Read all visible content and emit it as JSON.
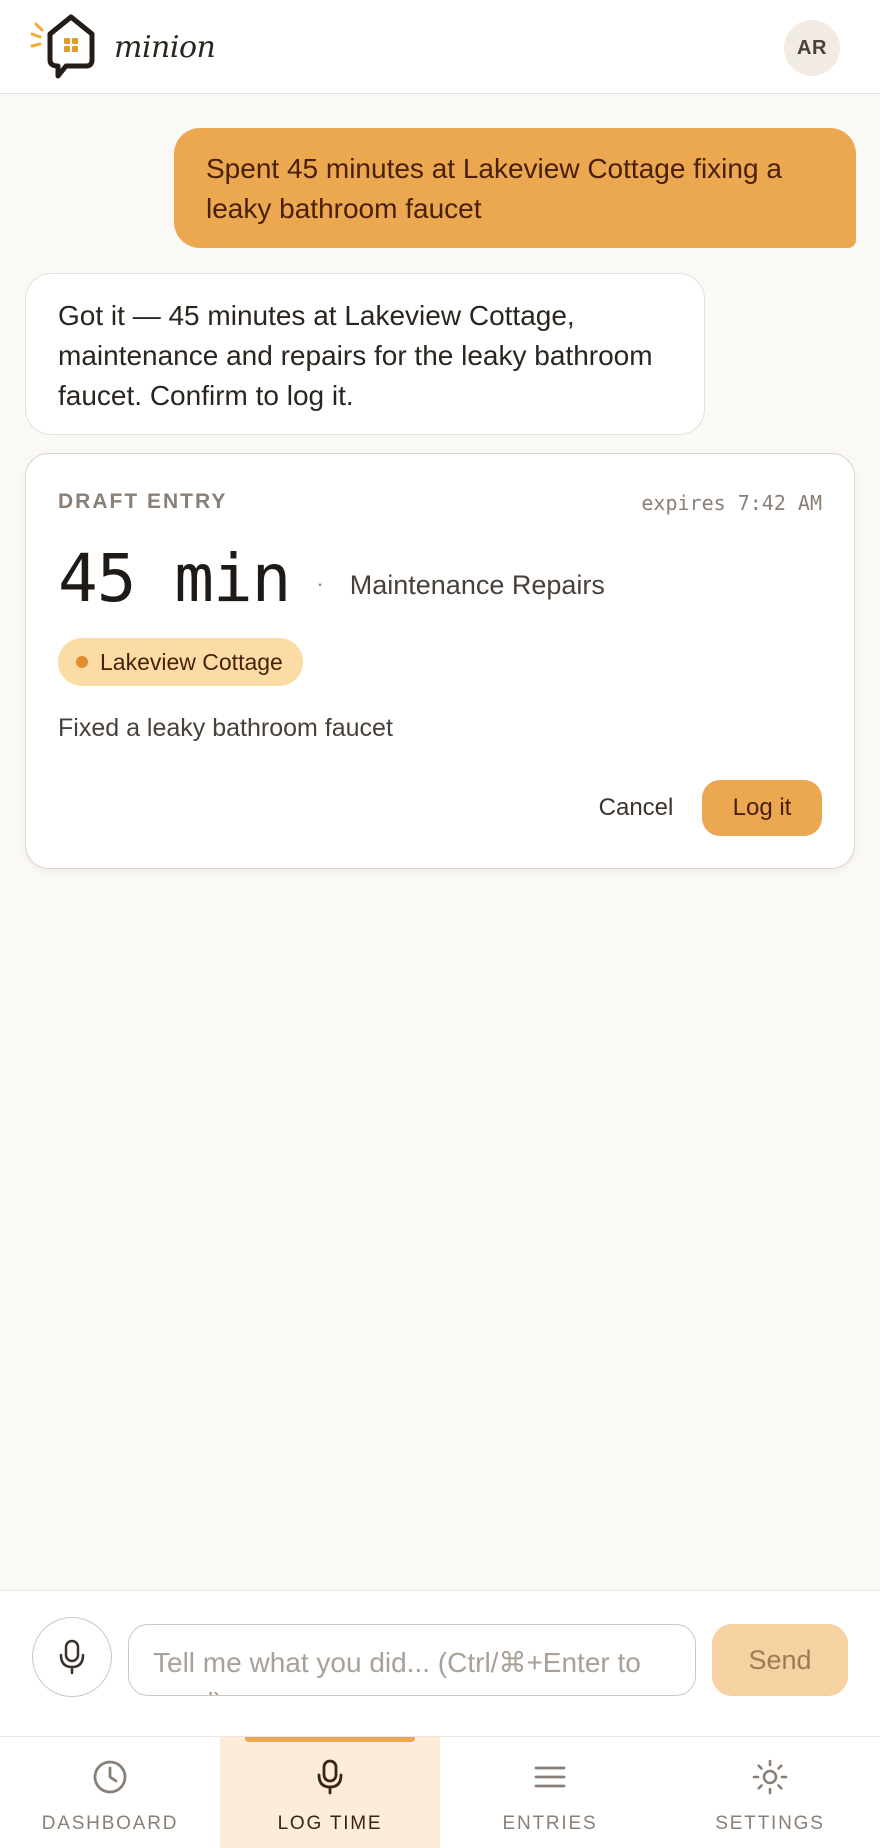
{
  "header": {
    "app_name": "minion",
    "avatar_initials": "AR"
  },
  "chat": {
    "user_message": "Spent 45 minutes at Lakeview Cottage fixing a leaky bathroom faucet",
    "assistant_message": "Got it — 45 minutes at Lakeview Cottage, maintenance and repairs for the leaky bathroom faucet. Confirm to log it."
  },
  "draft": {
    "label": "DRAFT ENTRY",
    "expires": "expires 7:42 AM",
    "duration": "45 min",
    "separator": "·",
    "category": "Maintenance Repairs",
    "location": "Lakeview Cottage",
    "description": "Fixed a leaky bathroom faucet",
    "cancel_label": "Cancel",
    "confirm_label": "Log it"
  },
  "composer": {
    "placeholder": "Tell me what you did... (Ctrl/⌘+Enter to send)",
    "send_label": "Send"
  },
  "nav": {
    "items": [
      {
        "label": "DASHBOARD",
        "icon": "clock-icon"
      },
      {
        "label": "LOG TIME",
        "icon": "microphone-icon",
        "active": true
      },
      {
        "label": "ENTRIES",
        "icon": "menu-icon"
      },
      {
        "label": "SETTINGS",
        "icon": "sun-icon"
      }
    ]
  },
  "colors": {
    "accent": "#eba850",
    "accent_soft": "#fdecd8",
    "pill": "#fbdca4",
    "background": "#fbf9f6"
  }
}
